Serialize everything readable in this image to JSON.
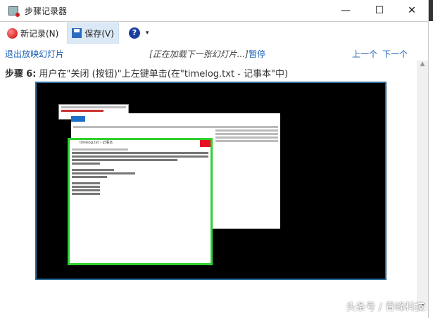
{
  "window": {
    "title": "步骤记录器",
    "minimize": "—",
    "maximize": "☐",
    "close": "✕"
  },
  "toolbar": {
    "new_record": "新记录(N)",
    "save": "保存(V)",
    "help": "?",
    "dropdown": "▾"
  },
  "slideshow": {
    "exit": "退出放映幻灯片",
    "status": "[正在加载下一张幻灯片...]",
    "pause": "暂停",
    "prev": "上一个",
    "next": "下一个"
  },
  "step": {
    "label": "步骤",
    "number": "6:",
    "description": "用户在\"关闭 (按钮)\"上左键单击(在\"timelog.txt - 记事本\"中)"
  },
  "screenshot": {
    "notepad_title": "timelog.txt - 记事本"
  },
  "scrollbar": {
    "up": "▲",
    "down": "▼"
  },
  "watermark": "头条号 / 青峰科技"
}
